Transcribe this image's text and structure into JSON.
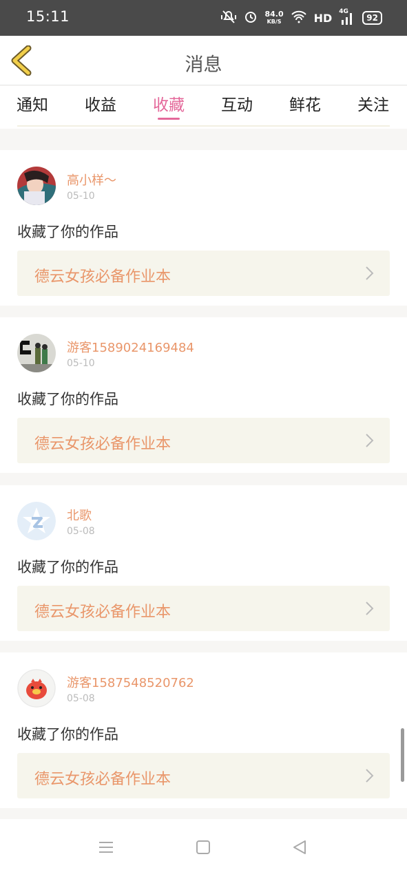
{
  "status_bar": {
    "time": "15:11",
    "net_speed": "84.0",
    "net_unit": "KB/S",
    "hd": "HD",
    "network": "4G",
    "battery": "92"
  },
  "header": {
    "title": "消息",
    "back_icon": "chevron-left-icon"
  },
  "tabs": [
    {
      "label": "通知",
      "active": false
    },
    {
      "label": "收益",
      "active": false
    },
    {
      "label": "收藏",
      "active": true
    },
    {
      "label": "互动",
      "active": false
    },
    {
      "label": "鲜花",
      "active": false
    },
    {
      "label": "关注",
      "active": false
    }
  ],
  "feed": [
    {
      "username": "高小样～",
      "date": "05-10",
      "action": "收藏了你的作品",
      "work_title": "德云女孩必备作业本"
    },
    {
      "username": "游客1589024169484",
      "date": "05-10",
      "action": "收藏了你的作品",
      "work_title": "德云女孩必备作业本"
    },
    {
      "username": "北歌",
      "date": "05-08",
      "action": "收藏了你的作品",
      "work_title": "德云女孩必备作业本"
    },
    {
      "username": "游客1587548520762",
      "date": "05-08",
      "action": "收藏了你的作品",
      "work_title": "德云女孩必备作业本"
    }
  ],
  "colors": {
    "accent": "#e4689a",
    "username": "#e9966a",
    "back_arrow": "#f2cf4a",
    "status_bar": "#4a4a4a"
  }
}
